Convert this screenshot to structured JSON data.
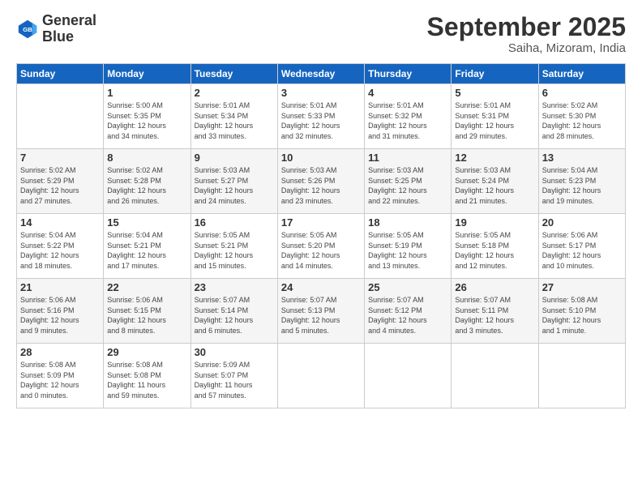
{
  "logo": {
    "line1": "General",
    "line2": "Blue"
  },
  "title": "September 2025",
  "subtitle": "Saiha, Mizoram, India",
  "weekdays": [
    "Sunday",
    "Monday",
    "Tuesday",
    "Wednesday",
    "Thursday",
    "Friday",
    "Saturday"
  ],
  "weeks": [
    [
      {
        "day": "",
        "info": ""
      },
      {
        "day": "1",
        "info": "Sunrise: 5:00 AM\nSunset: 5:35 PM\nDaylight: 12 hours\nand 34 minutes."
      },
      {
        "day": "2",
        "info": "Sunrise: 5:01 AM\nSunset: 5:34 PM\nDaylight: 12 hours\nand 33 minutes."
      },
      {
        "day": "3",
        "info": "Sunrise: 5:01 AM\nSunset: 5:33 PM\nDaylight: 12 hours\nand 32 minutes."
      },
      {
        "day": "4",
        "info": "Sunrise: 5:01 AM\nSunset: 5:32 PM\nDaylight: 12 hours\nand 31 minutes."
      },
      {
        "day": "5",
        "info": "Sunrise: 5:01 AM\nSunset: 5:31 PM\nDaylight: 12 hours\nand 29 minutes."
      },
      {
        "day": "6",
        "info": "Sunrise: 5:02 AM\nSunset: 5:30 PM\nDaylight: 12 hours\nand 28 minutes."
      }
    ],
    [
      {
        "day": "7",
        "info": "Sunrise: 5:02 AM\nSunset: 5:29 PM\nDaylight: 12 hours\nand 27 minutes."
      },
      {
        "day": "8",
        "info": "Sunrise: 5:02 AM\nSunset: 5:28 PM\nDaylight: 12 hours\nand 26 minutes."
      },
      {
        "day": "9",
        "info": "Sunrise: 5:03 AM\nSunset: 5:27 PM\nDaylight: 12 hours\nand 24 minutes."
      },
      {
        "day": "10",
        "info": "Sunrise: 5:03 AM\nSunset: 5:26 PM\nDaylight: 12 hours\nand 23 minutes."
      },
      {
        "day": "11",
        "info": "Sunrise: 5:03 AM\nSunset: 5:25 PM\nDaylight: 12 hours\nand 22 minutes."
      },
      {
        "day": "12",
        "info": "Sunrise: 5:03 AM\nSunset: 5:24 PM\nDaylight: 12 hours\nand 21 minutes."
      },
      {
        "day": "13",
        "info": "Sunrise: 5:04 AM\nSunset: 5:23 PM\nDaylight: 12 hours\nand 19 minutes."
      }
    ],
    [
      {
        "day": "14",
        "info": "Sunrise: 5:04 AM\nSunset: 5:22 PM\nDaylight: 12 hours\nand 18 minutes."
      },
      {
        "day": "15",
        "info": "Sunrise: 5:04 AM\nSunset: 5:21 PM\nDaylight: 12 hours\nand 17 minutes."
      },
      {
        "day": "16",
        "info": "Sunrise: 5:05 AM\nSunset: 5:21 PM\nDaylight: 12 hours\nand 15 minutes."
      },
      {
        "day": "17",
        "info": "Sunrise: 5:05 AM\nSunset: 5:20 PM\nDaylight: 12 hours\nand 14 minutes."
      },
      {
        "day": "18",
        "info": "Sunrise: 5:05 AM\nSunset: 5:19 PM\nDaylight: 12 hours\nand 13 minutes."
      },
      {
        "day": "19",
        "info": "Sunrise: 5:05 AM\nSunset: 5:18 PM\nDaylight: 12 hours\nand 12 minutes."
      },
      {
        "day": "20",
        "info": "Sunrise: 5:06 AM\nSunset: 5:17 PM\nDaylight: 12 hours\nand 10 minutes."
      }
    ],
    [
      {
        "day": "21",
        "info": "Sunrise: 5:06 AM\nSunset: 5:16 PM\nDaylight: 12 hours\nand 9 minutes."
      },
      {
        "day": "22",
        "info": "Sunrise: 5:06 AM\nSunset: 5:15 PM\nDaylight: 12 hours\nand 8 minutes."
      },
      {
        "day": "23",
        "info": "Sunrise: 5:07 AM\nSunset: 5:14 PM\nDaylight: 12 hours\nand 6 minutes."
      },
      {
        "day": "24",
        "info": "Sunrise: 5:07 AM\nSunset: 5:13 PM\nDaylight: 12 hours\nand 5 minutes."
      },
      {
        "day": "25",
        "info": "Sunrise: 5:07 AM\nSunset: 5:12 PM\nDaylight: 12 hours\nand 4 minutes."
      },
      {
        "day": "26",
        "info": "Sunrise: 5:07 AM\nSunset: 5:11 PM\nDaylight: 12 hours\nand 3 minutes."
      },
      {
        "day": "27",
        "info": "Sunrise: 5:08 AM\nSunset: 5:10 PM\nDaylight: 12 hours\nand 1 minute."
      }
    ],
    [
      {
        "day": "28",
        "info": "Sunrise: 5:08 AM\nSunset: 5:09 PM\nDaylight: 12 hours\nand 0 minutes."
      },
      {
        "day": "29",
        "info": "Sunrise: 5:08 AM\nSunset: 5:08 PM\nDaylight: 11 hours\nand 59 minutes."
      },
      {
        "day": "30",
        "info": "Sunrise: 5:09 AM\nSunset: 5:07 PM\nDaylight: 11 hours\nand 57 minutes."
      },
      {
        "day": "",
        "info": ""
      },
      {
        "day": "",
        "info": ""
      },
      {
        "day": "",
        "info": ""
      },
      {
        "day": "",
        "info": ""
      }
    ]
  ]
}
